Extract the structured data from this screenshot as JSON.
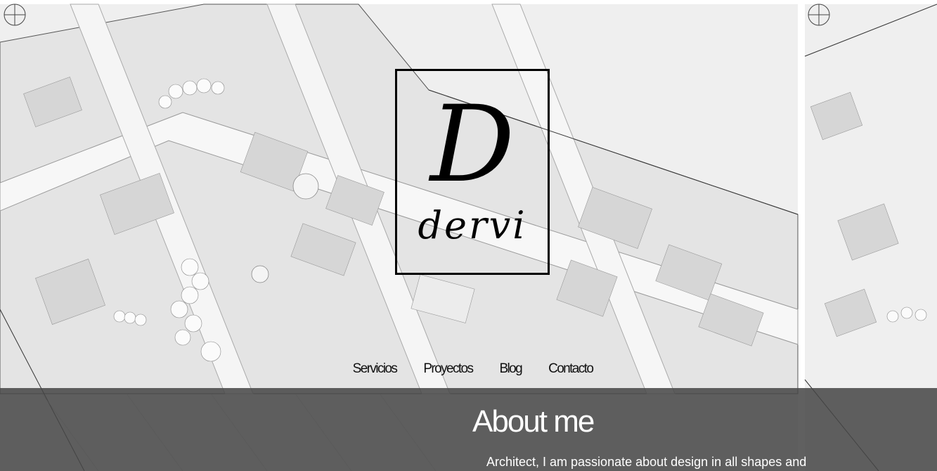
{
  "logo": {
    "letter": "D",
    "word": "dervi"
  },
  "nav": {
    "items": [
      {
        "label": "Servicios"
      },
      {
        "label": "Proyectos"
      },
      {
        "label": "Blog"
      },
      {
        "label": "Contacto"
      }
    ]
  },
  "about": {
    "title": "About me",
    "text": "Architect, I am passionate about design in all shapes and"
  },
  "colors": {
    "overlay": "#4a4a4a",
    "logo_border": "#000000",
    "map_background": "#f2f2f2"
  }
}
